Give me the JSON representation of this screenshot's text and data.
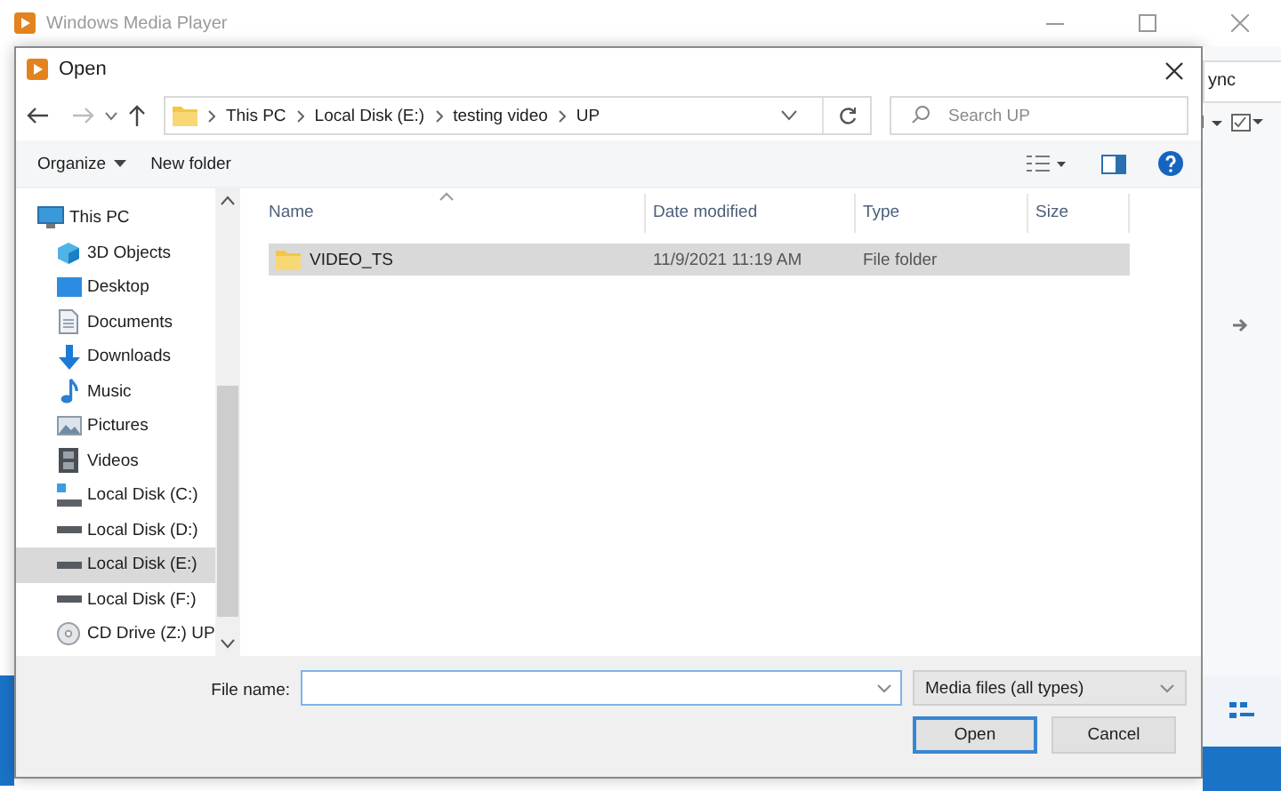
{
  "app": {
    "title": "Windows Media Player",
    "tab_label": "ync"
  },
  "dialog": {
    "title": "Open",
    "path": [
      "This PC",
      "Local Disk (E:)",
      "testing video",
      "UP"
    ],
    "search": {
      "placeholder": "Search UP"
    },
    "toolbar": [
      {
        "label": "Organize",
        "kind": "menu"
      },
      {
        "label": "New folder",
        "kind": "button"
      }
    ],
    "nav": [
      {
        "label": "This PC",
        "kind": "pc",
        "selected": false,
        "children": [
          {
            "label": "3D Objects",
            "kind": "cube",
            "selected": false
          },
          {
            "label": "Desktop",
            "kind": "desktop",
            "selected": false
          },
          {
            "label": "Documents",
            "kind": "document",
            "selected": false
          },
          {
            "label": "Downloads",
            "kind": "download",
            "selected": false
          },
          {
            "label": "Music",
            "kind": "music",
            "selected": false
          },
          {
            "label": "Pictures",
            "kind": "pictures",
            "selected": false
          },
          {
            "label": "Videos",
            "kind": "videos",
            "selected": false
          },
          {
            "label": "Local Disk (C:)",
            "kind": "system-drive",
            "selected": false
          },
          {
            "label": "Local Disk (D:)",
            "kind": "drive",
            "selected": false
          },
          {
            "label": "Local Disk (E:)",
            "kind": "drive",
            "selected": true
          },
          {
            "label": "Local Disk (F:)",
            "kind": "drive",
            "selected": false
          },
          {
            "label": "CD Drive (Z:) UP",
            "kind": "cd",
            "selected": false
          }
        ]
      }
    ],
    "columns": [
      "Name",
      "Date modified",
      "Type",
      "Size"
    ],
    "files": [
      {
        "name": "VIDEO_TS",
        "date": "11/9/2021 11:19 AM",
        "type": "File folder",
        "selected": true
      }
    ],
    "file_name_label": "File name:",
    "file_type": "Media files (all types)",
    "buttons": [
      {
        "label": "Open",
        "default": true
      },
      {
        "label": "Cancel",
        "default": false
      }
    ]
  }
}
